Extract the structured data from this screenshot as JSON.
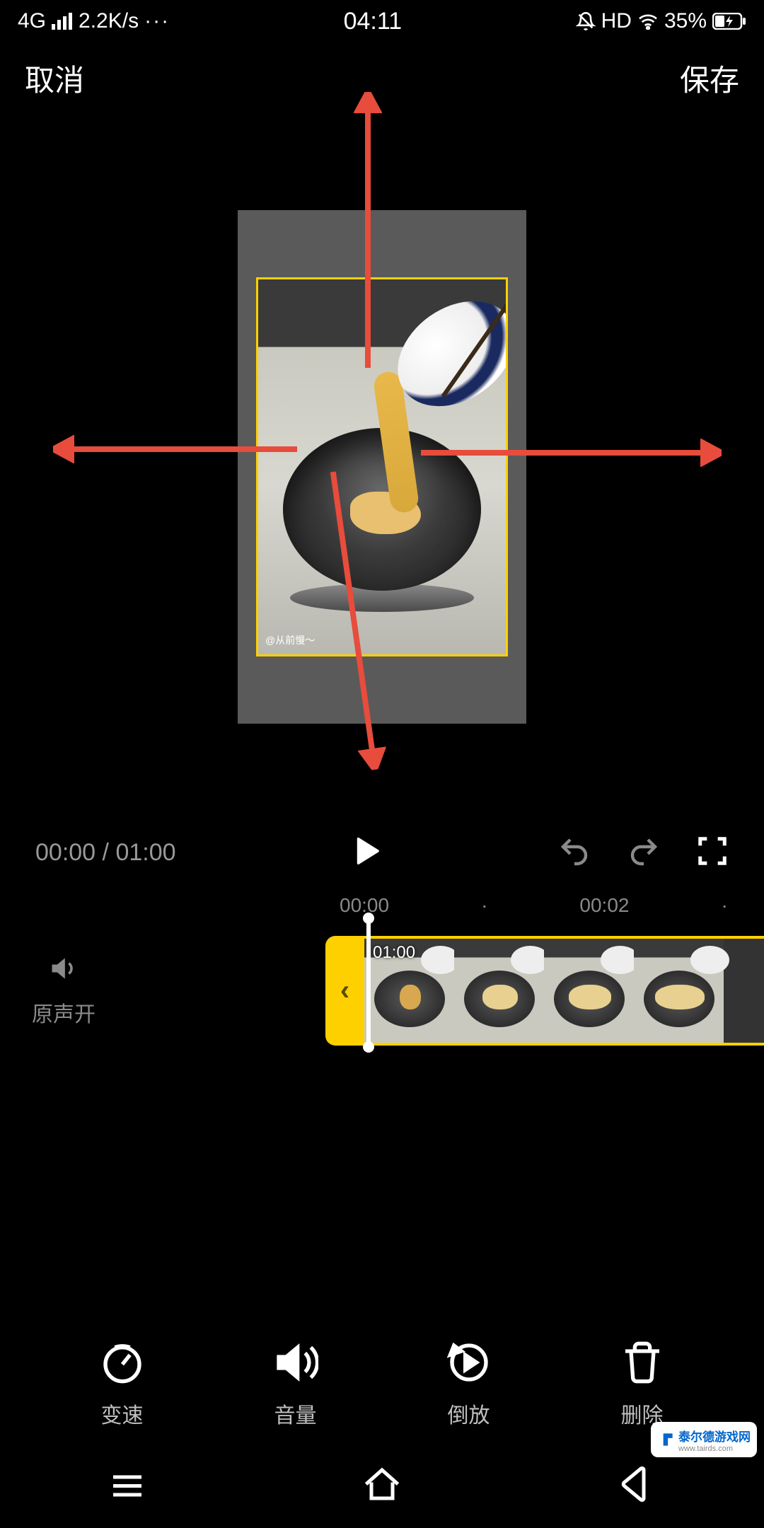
{
  "status": {
    "network": "4G",
    "speed": "2.2K/s",
    "more": "···",
    "time": "04:11",
    "hd": "HD",
    "battery": "35%"
  },
  "top": {
    "cancel": "取消",
    "save": "保存"
  },
  "preview": {
    "watermark": "@从前慢～"
  },
  "playback": {
    "current": "00:00",
    "sep": " / ",
    "total": "01:00"
  },
  "ruler": {
    "t0": "00:00",
    "dot1": "·",
    "t2": "00:02",
    "dot2": "·"
  },
  "timeline": {
    "sound_label": "原声开",
    "handle_glyph": "‹",
    "clip_duration": "01:00"
  },
  "tools": {
    "speed": "变速",
    "volume": "音量",
    "reverse": "倒放",
    "delete": "删除"
  },
  "badge": {
    "text": "泰尔德游戏网",
    "sub": "www.tairds.com"
  }
}
